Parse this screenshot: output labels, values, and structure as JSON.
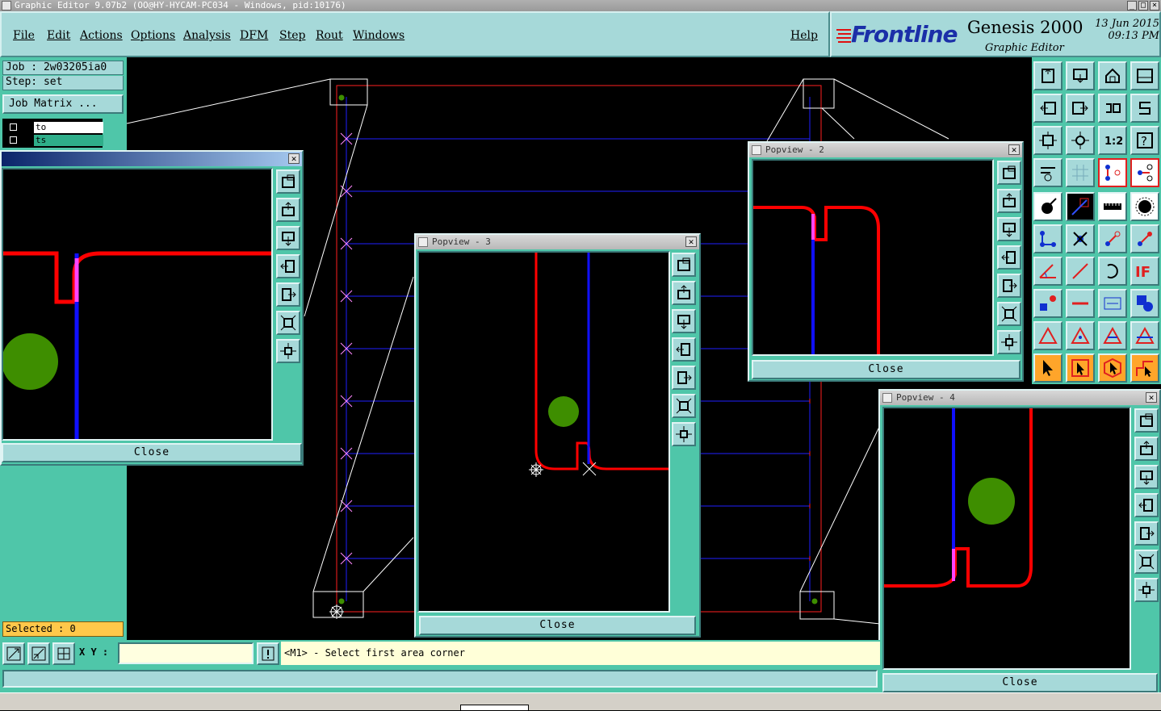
{
  "window": {
    "title": "Graphic Editor 9.07b2  (OO@HY-HYCAM-PC034 - Windows, pid:10176)"
  },
  "menu": {
    "items": [
      "File",
      "Edit",
      "Actions",
      "Options",
      "Analysis",
      "DFM",
      "Step",
      "Rout",
      "Windows"
    ],
    "help": "Help"
  },
  "brand": {
    "logo": "Frontline",
    "product": "Genesis 2000",
    "subtitle": "Graphic Editor",
    "date": "13  Jun  2015",
    "time": "09:13  PM"
  },
  "left_panel": {
    "job": "Job : 2w03205ia0",
    "step": "Step: set",
    "job_matrix": "Job Matrix ...",
    "layers": [
      {
        "name": "to"
      },
      {
        "name": "ts"
      }
    ],
    "selected": "Selected : 0"
  },
  "popviews": [
    {
      "title": "",
      "close": "Close"
    },
    {
      "title": "Popview - 2",
      "close": "Close"
    },
    {
      "title": "Popview - 3",
      "close": "Close"
    },
    {
      "title": "Popview - 4",
      "close": "Close"
    }
  ],
  "status": {
    "xy_label": "X Y :",
    "xy_value": "",
    "message": "<M1> - Select first area corner"
  },
  "colors": {
    "panel": "#4fc6a9",
    "button": "#a6d9d9",
    "trace_red": "#ff0000",
    "trace_blue": "#0000ff",
    "pad_green": "#3e8e00",
    "highlight_magenta": "#ff44ff",
    "selected_bg": "#ffc84a"
  }
}
